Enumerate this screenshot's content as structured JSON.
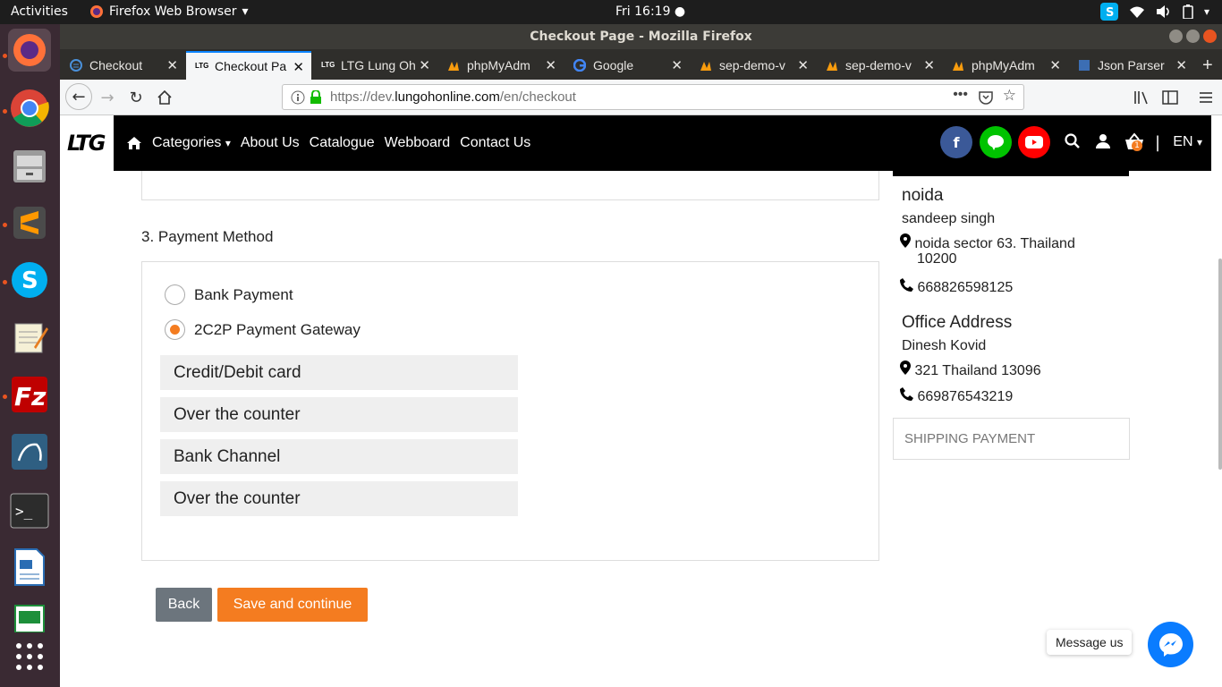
{
  "system": {
    "activities": "Activities",
    "app_name": "Firefox Web Browser",
    "clock": "Fri 16:19"
  },
  "window": {
    "title": "Checkout Page - Mozilla Firefox"
  },
  "tabs": [
    {
      "label": "Checkout"
    },
    {
      "label": "Checkout Pa"
    },
    {
      "label": "LTG Lung Oh"
    },
    {
      "label": "phpMyAdm"
    },
    {
      "label": "Google"
    },
    {
      "label": "sep-demo-v"
    },
    {
      "label": "sep-demo-v"
    },
    {
      "label": "phpMyAdm"
    },
    {
      "label": "Json Parser"
    }
  ],
  "url": {
    "prefix": "https://dev.",
    "domain": "lungohonline.com",
    "path": "/en/checkout"
  },
  "site": {
    "logo": "LTG",
    "menu": {
      "categories": "Categories",
      "about": "About Us",
      "catalogue": "Catalogue",
      "webboard": "Webboard",
      "contact": "Contact Us"
    },
    "lang": "EN",
    "cart_count": "1"
  },
  "payment": {
    "section_title": "3. Payment Method",
    "bank_payment": "Bank Payment",
    "gateway": "2C2P Payment Gateway",
    "options": [
      "Credit/Debit card",
      "Over the counter",
      "Bank Channel",
      "Over the counter"
    ],
    "selected": "2C2P Payment Gateway"
  },
  "buttons": {
    "back": "Back",
    "save": "Save and continue"
  },
  "sidebar": {
    "city": "noida",
    "name": "sandeep singh",
    "address": "noida sector 63. Thailand",
    "zip": "10200",
    "phone": "668826598125",
    "office_title": "Office Address",
    "office_name": "Dinesh Kovid",
    "office_address": "321 Thailand 13096",
    "office_phone": "669876543219",
    "shipping_payment": "SHIPPING PAYMENT"
  },
  "messenger": {
    "label": "Message us"
  },
  "colors": {
    "accent": "#f47c20",
    "back_button": "#6c757d",
    "facebook": "#3b5998",
    "line": "#00c300",
    "youtube": "#ff0000",
    "messenger": "#0a7cff"
  }
}
